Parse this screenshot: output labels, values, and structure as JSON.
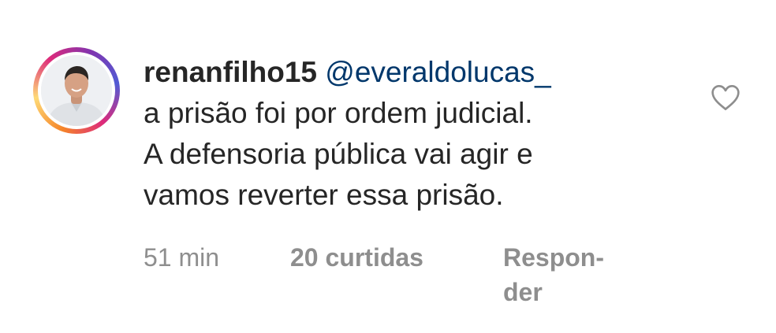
{
  "comment": {
    "username": "renanfilho15",
    "mention": "@everaldolucas_",
    "text_line_1": "a prisão foi por ordem judicial.",
    "text_line_2": "A defensoria pública vai agir e",
    "text_line_3": "vamos reverter essa prisão.",
    "time": "51 min",
    "likes": "20 curtidas",
    "reply_part_1": "Respon-",
    "reply_part_2": "der",
    "like_icon": "heart-outline-icon",
    "avatar_ring_colors": [
      "#f58529",
      "#feda77",
      "#dd2a7b",
      "#8134af",
      "#515bd4"
    ],
    "mention_color": "#00376b",
    "meta_color": "#8e8e8e"
  }
}
